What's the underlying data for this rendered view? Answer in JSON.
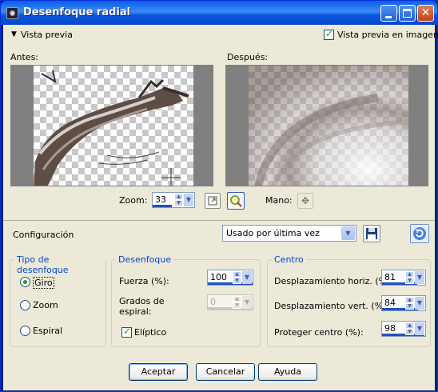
{
  "window": {
    "title": "Desenfoque radial"
  },
  "preview": {
    "toggle_label": "Vista previa",
    "show_in_image_label": "Vista previa en imagen",
    "show_in_image_checked": true,
    "before_label": "Antes:",
    "after_label": "Después:",
    "zoom_label": "Zoom:",
    "zoom_value": "33",
    "hand_label": "Mano:"
  },
  "config": {
    "label": "Configuración",
    "preset_value": "Usado por última vez"
  },
  "blur_type": {
    "title": "Tipo de desenfoque",
    "options": [
      "Giro",
      "Zoom",
      "Espiral"
    ],
    "selected": "Giro"
  },
  "blur": {
    "title": "Desenfoque",
    "strength_label": "Fuerza (%):",
    "strength_value": "100",
    "spiral_degrees_label_1": "Grados de",
    "spiral_degrees_label_2": "espiral:",
    "spiral_degrees_value": "0",
    "elliptical_label": "Elíptico",
    "elliptical_checked": true
  },
  "center": {
    "title": "Centro",
    "h_offset_label": "Desplazamiento horiz. (%):",
    "h_offset_value": "81",
    "v_offset_label": "Desplazamiento vert. (%):",
    "v_offset_value": "84",
    "protect_label": "Proteger centro (%):",
    "protect_value": "98"
  },
  "buttons": {
    "ok": "Aceptar",
    "cancel": "Cancelar",
    "help": "Ayuda"
  }
}
